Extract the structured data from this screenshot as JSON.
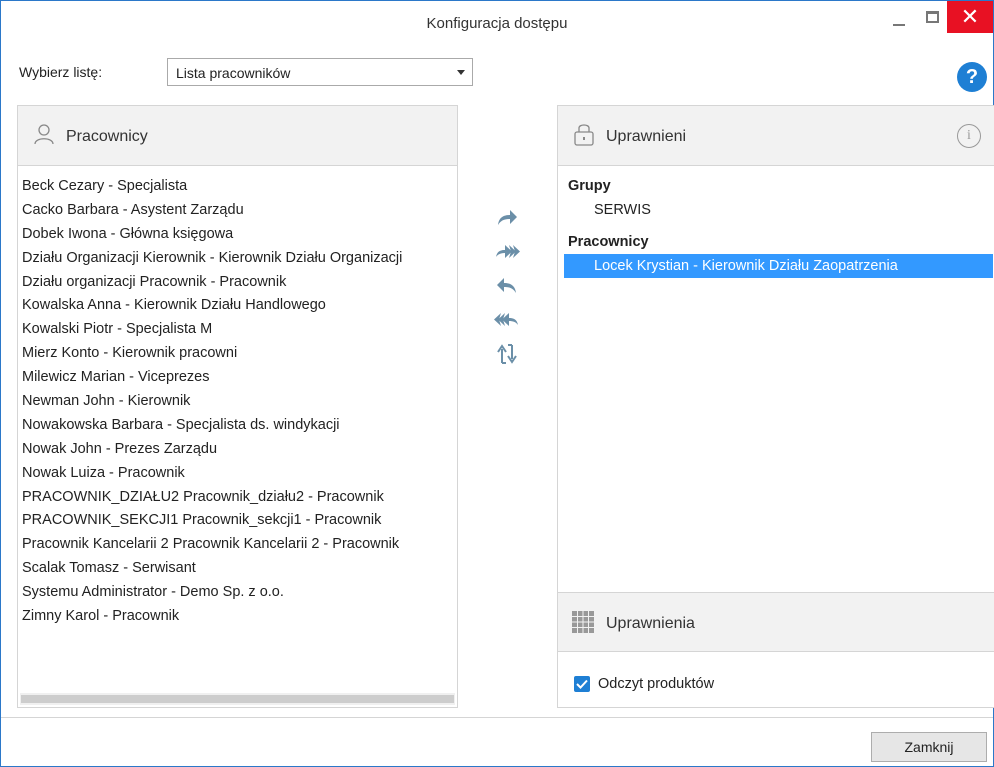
{
  "window": {
    "title": "Konfiguracja dostępu",
    "close_glyph": "✕"
  },
  "selector": {
    "label": "Wybierz listę:",
    "value": "Lista pracowników"
  },
  "help": {
    "glyph": "?"
  },
  "left_panel": {
    "title": "Pracownicy",
    "icon": "user-icon",
    "employees": [
      "Beck Cezary - Specjalista",
      "Cacko Barbara - Asystent Zarządu",
      "Dobek Iwona - Główna księgowa",
      "Działu Organizacji Kierownik - Kierownik Działu Organizacji",
      "Działu organizacji Pracownik - Pracownik",
      "Kowalska Anna - Kierownik Działu Handlowego",
      "Kowalski Piotr - Specjalista M",
      "Mierz Konto - Kierownik pracowni",
      "Milewicz Marian - Viceprezes",
      "Newman John - Kierownik",
      "Nowakowska Barbara - Specjalista ds. windykacji",
      "Nowak John - Prezes Zarządu",
      "Nowak Luiza - Pracownik",
      "PRACOWNIK_DZIAŁU2 Pracownik_działu2 - Pracownik",
      "PRACOWNIK_SEKCJI1 Pracownik_sekcji1 - Pracownik",
      "Pracownik Kancelarii 2 Pracownik Kancelarii 2 - Pracownik",
      "Scalak Tomasz - Serwisant",
      "Systemu Administrator - Demo Sp. z o.o.",
      "Zimny Karol - Pracownik"
    ]
  },
  "right_panel": {
    "title": "Uprawnieni",
    "icon": "lock-icon",
    "info_glyph": "i",
    "groups_heading": "Grupy",
    "groups": [
      "SERWIS"
    ],
    "employees_heading": "Pracownicy",
    "selected_employee": "Locek Krystian - Kierownik Działu Zaopatrzenia"
  },
  "permissions": {
    "title": "Uprawnienia",
    "icon": "grid-icon",
    "checkbox_label": "Odczyt produktów",
    "checked": true
  },
  "footer": {
    "close_label": "Zamknij"
  },
  "colors": {
    "accent": "#1e7fd4",
    "selection": "#3399ff",
    "close": "#e81123",
    "arrow": "#6b8fa8"
  }
}
